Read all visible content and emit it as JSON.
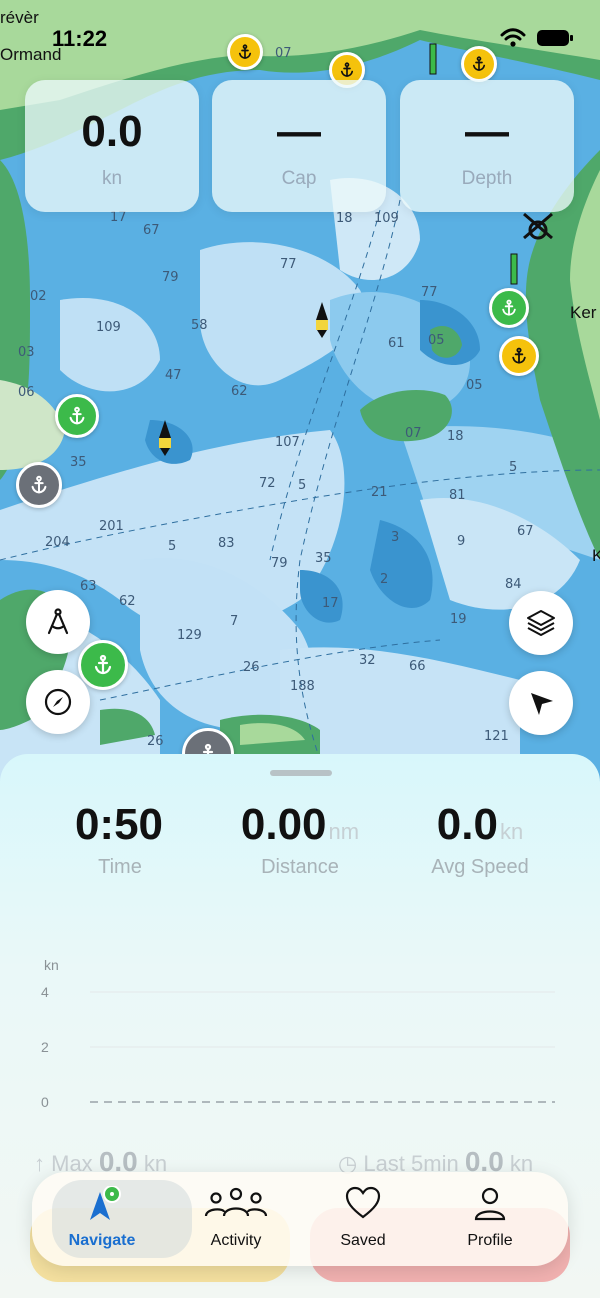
{
  "status": {
    "time": "11:22"
  },
  "map": {
    "place_labels": [
      "révèr",
      "Ormand",
      "Ker",
      "K"
    ],
    "depths": [
      {
        "v": "07"
      },
      {
        "v": "17"
      },
      {
        "v": "67"
      },
      {
        "v": "18"
      },
      {
        "v": "109"
      },
      {
        "v": "79"
      },
      {
        "v": "77"
      },
      {
        "v": "02"
      },
      {
        "v": "109"
      },
      {
        "v": "58"
      },
      {
        "v": "77"
      },
      {
        "v": "61"
      },
      {
        "v": "05"
      },
      {
        "v": "03"
      },
      {
        "v": "47"
      },
      {
        "v": "62"
      },
      {
        "v": "05"
      },
      {
        "v": "06"
      },
      {
        "v": "107"
      },
      {
        "v": "07"
      },
      {
        "v": "18"
      },
      {
        "v": "35"
      },
      {
        "v": "72"
      },
      {
        "v": "5"
      },
      {
        "v": "21"
      },
      {
        "v": "5"
      },
      {
        "v": "81"
      },
      {
        "v": "201"
      },
      {
        "v": "204"
      },
      {
        "v": "5"
      },
      {
        "v": "83"
      },
      {
        "v": "79"
      },
      {
        "v": "35"
      },
      {
        "v": "3"
      },
      {
        "v": "9"
      },
      {
        "v": "67"
      },
      {
        "v": "63"
      },
      {
        "v": "62"
      },
      {
        "v": "129"
      },
      {
        "v": "7"
      },
      {
        "v": "17"
      },
      {
        "v": "2"
      },
      {
        "v": "84"
      },
      {
        "v": "19"
      },
      {
        "v": "26"
      },
      {
        "v": "32"
      },
      {
        "v": "66"
      },
      {
        "v": "188"
      },
      {
        "v": "26"
      },
      {
        "v": "121"
      }
    ]
  },
  "top_stats": [
    {
      "value": "0.0",
      "label": "kn"
    },
    {
      "value": "—",
      "label": "Cap"
    },
    {
      "value": "—",
      "label": "Depth"
    }
  ],
  "track": {
    "time": {
      "value": "0:50",
      "unit": "",
      "label": "Time"
    },
    "distance": {
      "value": "0.00",
      "unit": "nm",
      "label": "Distance"
    },
    "avg_speed": {
      "value": "0.0",
      "unit": "kn",
      "label": "Avg Speed"
    }
  },
  "chart_data": {
    "type": "line",
    "ylabel": "kn",
    "yticks": [
      "4",
      "2",
      "0"
    ],
    "ylim": [
      0,
      4
    ],
    "series": [
      {
        "values": [
          0,
          0
        ]
      }
    ],
    "grid": true
  },
  "summary": {
    "max_label": "Max",
    "max_value": "0.0",
    "max_unit": "kn",
    "last_label": "Last 5min",
    "last_value": "0.0",
    "last_unit": "kn"
  },
  "tabs": [
    {
      "label": "Navigate",
      "icon": "navigate-arrow-icon",
      "active": true
    },
    {
      "label": "Activity",
      "icon": "group-icon",
      "active": false
    },
    {
      "label": "Saved",
      "icon": "heart-icon",
      "active": false
    },
    {
      "label": "Profile",
      "icon": "person-icon",
      "active": false
    }
  ],
  "colors": {
    "accent": "#1a6fd0",
    "marker_green": "#3cba4a",
    "marker_yellow": "#f5c20c",
    "marker_gray": "#6b7078",
    "water_deep": "#4aa8e0",
    "water_shallow": "#bfe0f5",
    "land": "#4fa86a"
  }
}
